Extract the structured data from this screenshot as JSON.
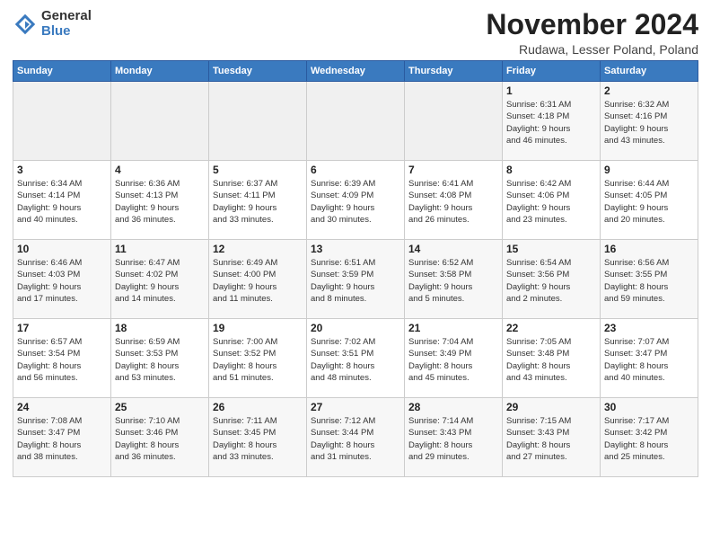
{
  "header": {
    "logo_general": "General",
    "logo_blue": "Blue",
    "month_title": "November 2024",
    "subtitle": "Rudawa, Lesser Poland, Poland"
  },
  "weekdays": [
    "Sunday",
    "Monday",
    "Tuesday",
    "Wednesday",
    "Thursday",
    "Friday",
    "Saturday"
  ],
  "weeks": [
    [
      {
        "day": null,
        "info": ""
      },
      {
        "day": null,
        "info": ""
      },
      {
        "day": null,
        "info": ""
      },
      {
        "day": null,
        "info": ""
      },
      {
        "day": null,
        "info": ""
      },
      {
        "day": "1",
        "info": "Sunrise: 6:31 AM\nSunset: 4:18 PM\nDaylight: 9 hours\nand 46 minutes."
      },
      {
        "day": "2",
        "info": "Sunrise: 6:32 AM\nSunset: 4:16 PM\nDaylight: 9 hours\nand 43 minutes."
      }
    ],
    [
      {
        "day": "3",
        "info": "Sunrise: 6:34 AM\nSunset: 4:14 PM\nDaylight: 9 hours\nand 40 minutes."
      },
      {
        "day": "4",
        "info": "Sunrise: 6:36 AM\nSunset: 4:13 PM\nDaylight: 9 hours\nand 36 minutes."
      },
      {
        "day": "5",
        "info": "Sunrise: 6:37 AM\nSunset: 4:11 PM\nDaylight: 9 hours\nand 33 minutes."
      },
      {
        "day": "6",
        "info": "Sunrise: 6:39 AM\nSunset: 4:09 PM\nDaylight: 9 hours\nand 30 minutes."
      },
      {
        "day": "7",
        "info": "Sunrise: 6:41 AM\nSunset: 4:08 PM\nDaylight: 9 hours\nand 26 minutes."
      },
      {
        "day": "8",
        "info": "Sunrise: 6:42 AM\nSunset: 4:06 PM\nDaylight: 9 hours\nand 23 minutes."
      },
      {
        "day": "9",
        "info": "Sunrise: 6:44 AM\nSunset: 4:05 PM\nDaylight: 9 hours\nand 20 minutes."
      }
    ],
    [
      {
        "day": "10",
        "info": "Sunrise: 6:46 AM\nSunset: 4:03 PM\nDaylight: 9 hours\nand 17 minutes."
      },
      {
        "day": "11",
        "info": "Sunrise: 6:47 AM\nSunset: 4:02 PM\nDaylight: 9 hours\nand 14 minutes."
      },
      {
        "day": "12",
        "info": "Sunrise: 6:49 AM\nSunset: 4:00 PM\nDaylight: 9 hours\nand 11 minutes."
      },
      {
        "day": "13",
        "info": "Sunrise: 6:51 AM\nSunset: 3:59 PM\nDaylight: 9 hours\nand 8 minutes."
      },
      {
        "day": "14",
        "info": "Sunrise: 6:52 AM\nSunset: 3:58 PM\nDaylight: 9 hours\nand 5 minutes."
      },
      {
        "day": "15",
        "info": "Sunrise: 6:54 AM\nSunset: 3:56 PM\nDaylight: 9 hours\nand 2 minutes."
      },
      {
        "day": "16",
        "info": "Sunrise: 6:56 AM\nSunset: 3:55 PM\nDaylight: 8 hours\nand 59 minutes."
      }
    ],
    [
      {
        "day": "17",
        "info": "Sunrise: 6:57 AM\nSunset: 3:54 PM\nDaylight: 8 hours\nand 56 minutes."
      },
      {
        "day": "18",
        "info": "Sunrise: 6:59 AM\nSunset: 3:53 PM\nDaylight: 8 hours\nand 53 minutes."
      },
      {
        "day": "19",
        "info": "Sunrise: 7:00 AM\nSunset: 3:52 PM\nDaylight: 8 hours\nand 51 minutes."
      },
      {
        "day": "20",
        "info": "Sunrise: 7:02 AM\nSunset: 3:51 PM\nDaylight: 8 hours\nand 48 minutes."
      },
      {
        "day": "21",
        "info": "Sunrise: 7:04 AM\nSunset: 3:49 PM\nDaylight: 8 hours\nand 45 minutes."
      },
      {
        "day": "22",
        "info": "Sunrise: 7:05 AM\nSunset: 3:48 PM\nDaylight: 8 hours\nand 43 minutes."
      },
      {
        "day": "23",
        "info": "Sunrise: 7:07 AM\nSunset: 3:47 PM\nDaylight: 8 hours\nand 40 minutes."
      }
    ],
    [
      {
        "day": "24",
        "info": "Sunrise: 7:08 AM\nSunset: 3:47 PM\nDaylight: 8 hours\nand 38 minutes."
      },
      {
        "day": "25",
        "info": "Sunrise: 7:10 AM\nSunset: 3:46 PM\nDaylight: 8 hours\nand 36 minutes."
      },
      {
        "day": "26",
        "info": "Sunrise: 7:11 AM\nSunset: 3:45 PM\nDaylight: 8 hours\nand 33 minutes."
      },
      {
        "day": "27",
        "info": "Sunrise: 7:12 AM\nSunset: 3:44 PM\nDaylight: 8 hours\nand 31 minutes."
      },
      {
        "day": "28",
        "info": "Sunrise: 7:14 AM\nSunset: 3:43 PM\nDaylight: 8 hours\nand 29 minutes."
      },
      {
        "day": "29",
        "info": "Sunrise: 7:15 AM\nSunset: 3:43 PM\nDaylight: 8 hours\nand 27 minutes."
      },
      {
        "day": "30",
        "info": "Sunrise: 7:17 AM\nSunset: 3:42 PM\nDaylight: 8 hours\nand 25 minutes."
      }
    ]
  ]
}
